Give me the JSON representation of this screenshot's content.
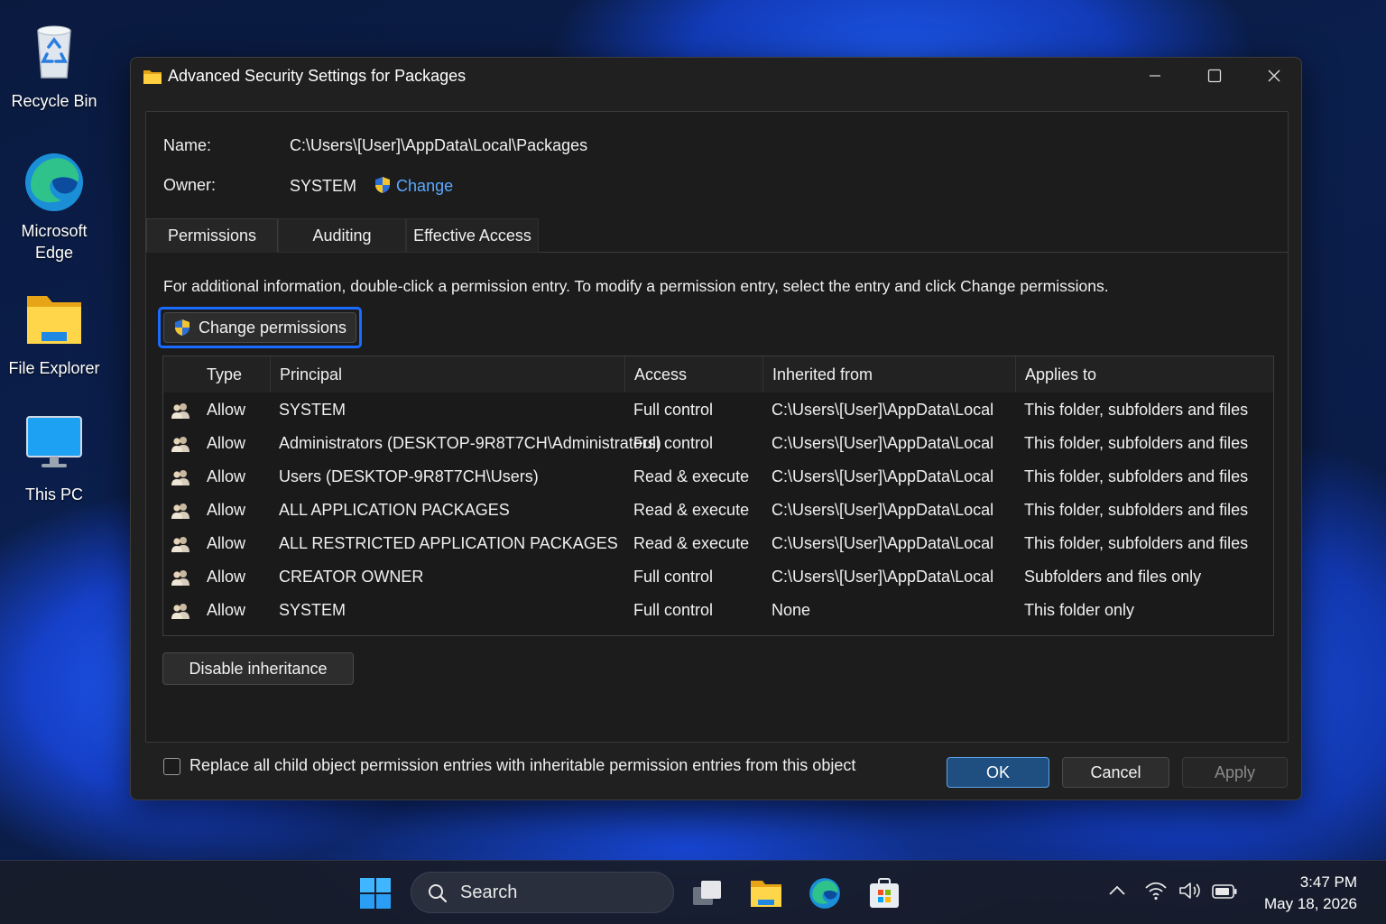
{
  "desktop": {
    "icons": [
      {
        "label": "Recycle Bin",
        "icon": "recycle-bin-icon"
      },
      {
        "label": "Microsoft Edge",
        "icon": "edge-icon"
      },
      {
        "label": "File Explorer",
        "icon": "folder-icon"
      },
      {
        "label": "This PC",
        "icon": "monitor-icon"
      }
    ]
  },
  "dialog": {
    "title": "Advanced Security Settings for Packages",
    "name_label": "Name:",
    "name_value": "C:\\Users\\[User]\\AppData\\Local\\Packages",
    "owner_label": "Owner:",
    "owner_value": "SYSTEM",
    "owner_change": "Change",
    "tabs": [
      {
        "label": "Permissions",
        "active": true
      },
      {
        "label": "Auditing",
        "active": false
      },
      {
        "label": "Effective Access",
        "active": false
      }
    ],
    "info_text": "For additional information, double-click a permission entry. To modify a permission entry, select the entry and click Change permissions.",
    "change_permissions": "Change permissions",
    "table": {
      "headers": [
        "Type",
        "Principal",
        "Access",
        "Inherited from",
        "Applies to"
      ],
      "rows": [
        {
          "type": "Allow",
          "principal": "SYSTEM",
          "access": "Full control",
          "inherited": "C:\\Users\\[User]\\AppData\\Local",
          "applies": "This folder, subfolders and files"
        },
        {
          "type": "Allow",
          "principal": "Administrators (DESKTOP-9R8T7CH\\Administrators)",
          "access": "Full control",
          "inherited": "C:\\Users\\[User]\\AppData\\Local",
          "applies": "This folder, subfolders and files"
        },
        {
          "type": "Allow",
          "principal": "Users (DESKTOP-9R8T7CH\\Users)",
          "access": "Read & execute",
          "inherited": "C:\\Users\\[User]\\AppData\\Local",
          "applies": "This folder, subfolders and files"
        },
        {
          "type": "Allow",
          "principal": "ALL APPLICATION PACKAGES",
          "access": "Read & execute",
          "inherited": "C:\\Users\\[User]\\AppData\\Local",
          "applies": "This folder, subfolders and files"
        },
        {
          "type": "Allow",
          "principal": "ALL RESTRICTED APPLICATION PACKAGES",
          "access": "Read & execute",
          "inherited": "C:\\Users\\[User]\\AppData\\Local",
          "applies": "This folder, subfolders and files"
        },
        {
          "type": "Allow",
          "principal": "CREATOR OWNER",
          "access": "Full control",
          "inherited": "C:\\Users\\[User]\\AppData\\Local",
          "applies": "Subfolders and files only"
        },
        {
          "type": "Allow",
          "principal": "SYSTEM",
          "access": "Full control",
          "inherited": "None",
          "applies": "This folder only"
        }
      ]
    },
    "disable_inheritance": "Disable inheritance",
    "replace_child_label": "Replace all child object permission entries with inheritable permission entries from this object",
    "replace_child_checked": false,
    "ok": "OK",
    "cancel": "Cancel",
    "apply": "Apply"
  },
  "taskbar": {
    "search_label": "Search",
    "time": "3:47 PM",
    "date": "May 18, 2026"
  },
  "colors": {
    "accent": "#1a6bff",
    "link": "#5aa9ff",
    "dialog_bg": "#202020"
  }
}
